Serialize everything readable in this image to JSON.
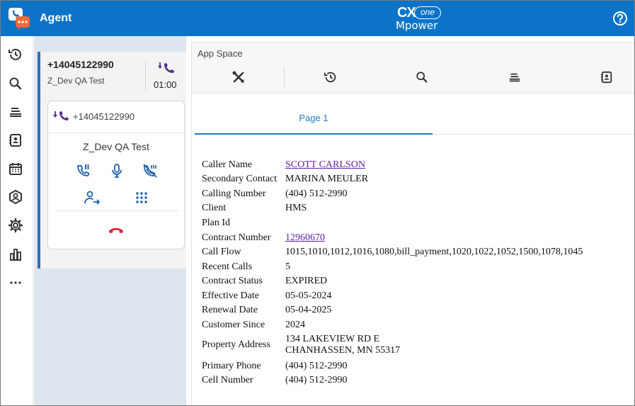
{
  "header": {
    "title": "Agent",
    "logo": {
      "cx": "CX",
      "one": "one",
      "mpower": "Mpower"
    },
    "brand_color": "#0b73c8",
    "help_icon": "help-circle-icon"
  },
  "rail": {
    "items": [
      {
        "name": "history-icon"
      },
      {
        "name": "search-icon"
      },
      {
        "name": "queue-icon"
      },
      {
        "name": "directory-icon"
      },
      {
        "name": "calendar-icon"
      },
      {
        "name": "profile-icon"
      },
      {
        "name": "settings-icon"
      },
      {
        "name": "reports-icon"
      },
      {
        "name": "more-icon"
      }
    ]
  },
  "contact_card": {
    "number": "+14045122990",
    "skill": "Z_Dev QA Test",
    "timer": "01:00"
  },
  "call": {
    "number": "+14045122990",
    "skill": "Z_Dev QA Test",
    "controls": [
      "hold-icon",
      "mute-icon",
      "mask-icon",
      "transfer-icon",
      "keypad-icon",
      "hangup-icon"
    ],
    "hangup_color": "#e0263a"
  },
  "appspace": {
    "title": "App Space",
    "tools": [
      "tools-icon",
      "history-icon",
      "search-icon",
      "queue-icon",
      "directory-icon"
    ],
    "tab": "Page 1",
    "accent": "#1f7ac8"
  },
  "details": {
    "caller_name_label": "Caller Name",
    "caller_name": "SCOTT CARLSON",
    "secondary_contact_label": "Secondary Contact",
    "secondary_contact": "MARINA MEULER",
    "calling_number_label": "Calling Number",
    "calling_number": "(404) 512-2990",
    "client_label": "Client",
    "client": "HMS",
    "plan_id_label": "Plan Id",
    "plan_id": "",
    "contract_number_label": "Contract Number",
    "contract_number": "12960670",
    "call_flow_label": "Call Flow",
    "call_flow": "1015,1010,1012,1016,1080,bill_payment,1020,1022,1052,1500,1078,1045",
    "recent_calls_label": "Recent Calls",
    "recent_calls": "5",
    "contract_status_label": "Contract Status",
    "contract_status": "EXPIRED",
    "effective_date_label": "Effective Date",
    "effective_date": "05-05-2024",
    "renewal_date_label": "Renewal Date",
    "renewal_date": "05-04-2025",
    "customer_since_label": "Customer Since",
    "customer_since": "2024",
    "property_address_label": "Property Address",
    "property_address_line1": "134 LAKEVIEW RD E",
    "property_address_line2": "CHANHASSEN, MN 55317",
    "primary_phone_label": "Primary Phone",
    "primary_phone": "(404) 512-2990",
    "cell_number_label": "Cell Number",
    "cell_number": "(404) 512-2990"
  }
}
